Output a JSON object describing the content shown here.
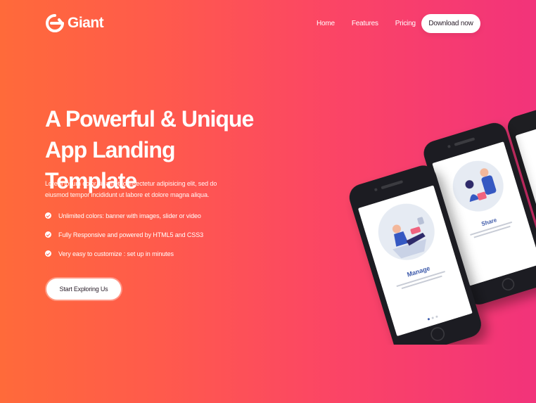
{
  "brand": {
    "name": "Giant"
  },
  "nav": {
    "items": [
      "Home",
      "Features",
      "Pricing"
    ],
    "download_label": "Download now"
  },
  "hero": {
    "title_line1": "A Powerful & Unique",
    "title_line2": "App Landing Template",
    "description": "Lorem ipsum dolor sit amet, consectetur adipisicing elit, sed do eiusmod tempor incididunt ut labore et dolore magna aliqua.",
    "features": [
      "Unlimited colors: banner with images, slider or video",
      "Fully Responsive and powered by HTML5 and CSS3",
      "Very easy to customize : set up in minutes"
    ],
    "cta_label": "Start Exploring Us"
  },
  "phones": {
    "front_screen_title": "Manage",
    "back_screen_title": "Share"
  },
  "colors": {
    "gradient_start": "#ff6a3a",
    "gradient_end": "#f2337a",
    "screen_title": "#2c4fa8"
  }
}
